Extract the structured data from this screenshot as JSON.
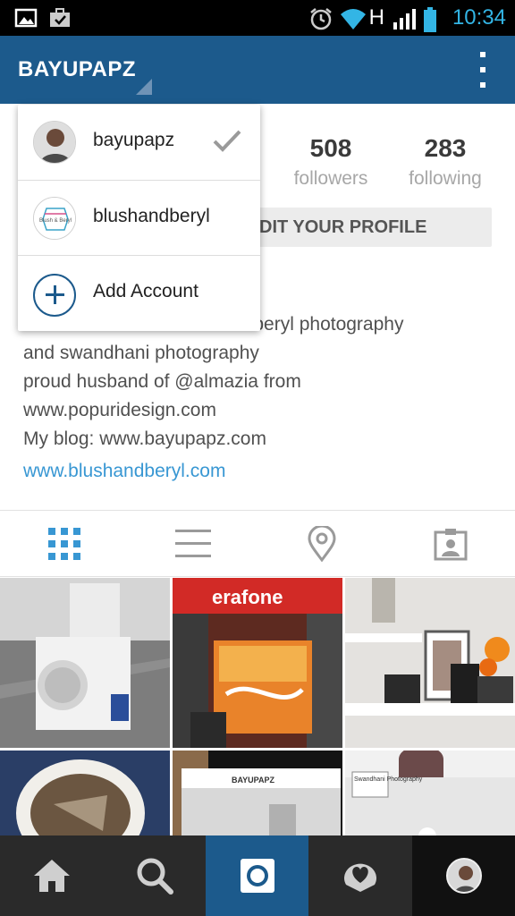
{
  "status_bar": {
    "time": "10:34",
    "network": "H",
    "icons": [
      "image-icon",
      "briefcase-icon",
      "alarm-icon",
      "wifi-icon",
      "signal-icon",
      "battery-icon"
    ]
  },
  "app_bar": {
    "username": "BAYUPAPZ",
    "menu_icon": "overflow-menu-icon"
  },
  "profile": {
    "followers_count": "508",
    "followers_label": "followers",
    "following_count": "283",
    "following_label": "following",
    "edit_button_label": "DIT YOUR PROFILE",
    "bio_lines": [
      "h & beryl photography",
      "and swandhani photography",
      "proud husband of @almazia from",
      "www.popuridesign.com",
      "My blog: www.bayupapz.com"
    ],
    "bio_link": "www.blushandberyl.com"
  },
  "account_switcher": {
    "items": [
      {
        "label": "bayupapz",
        "selected": true
      },
      {
        "label": "blushandberyl",
        "selected": false,
        "avatar_text": "Blush & Beryl"
      },
      {
        "label": "Add Account",
        "action": "add"
      }
    ]
  },
  "view_tabs": [
    "grid-icon",
    "list-icon",
    "location-pin-icon",
    "tagged-photos-icon"
  ],
  "grid_photos": [
    {
      "caption": "air conditioner units"
    },
    {
      "brand": "erafone"
    },
    {
      "caption": "camera shelf"
    },
    {
      "caption": "tea cup"
    },
    {
      "laptop_text": "BAYUPAPZ"
    },
    {
      "caption": "Swandhani Photography"
    }
  ],
  "bottom_nav": [
    "home-icon",
    "search-icon",
    "camera-icon",
    "activity-icon",
    "profile-avatar"
  ],
  "colors": {
    "app_bar": "#1c5a8c",
    "accent_blue": "#3897d3",
    "clock": "#33b5e5"
  }
}
